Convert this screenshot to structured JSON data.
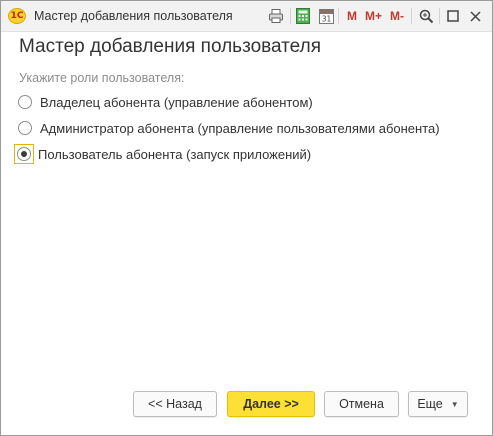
{
  "window": {
    "title": "Мастер добавления пользователя",
    "app_logo_text": "1С"
  },
  "toolbar": {
    "icons": [
      "print-icon",
      "calculator-icon",
      "calendar-icon"
    ],
    "calendar_day": "31",
    "memory_m": "M",
    "memory_m_plus": "M+",
    "memory_m_minus": "M-"
  },
  "main": {
    "heading": "Мастер добавления пользователя",
    "prompt": "Укажите роли пользователя:",
    "options": [
      {
        "label": "Владелец абонента (управление абонентом)",
        "checked": false
      },
      {
        "label": "Администратор абонента (управление пользователями абонента)",
        "checked": false
      },
      {
        "label": "Пользователь абонента (запуск приложений)",
        "checked": true
      }
    ]
  },
  "footer": {
    "back_label": "<< Назад",
    "next_label": "Далее >>",
    "cancel_label": "Отмена",
    "more_label": "Еще"
  },
  "colors": {
    "primary_button": "#fde035",
    "focus_ring": "#e1b800",
    "memory_buttons": "#c0392b"
  }
}
